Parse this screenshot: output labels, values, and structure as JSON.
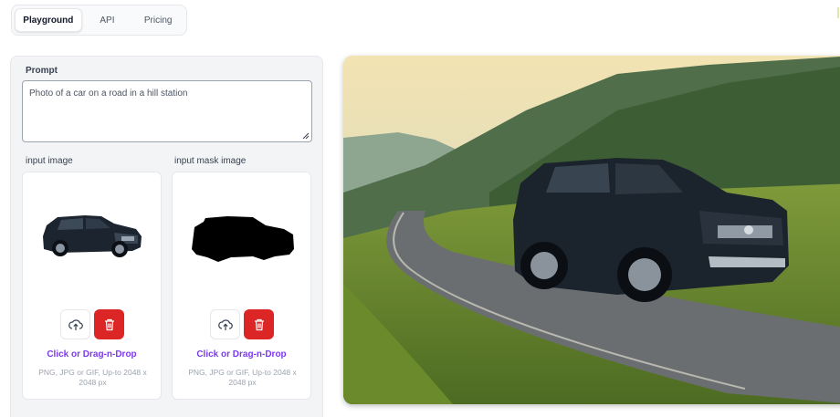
{
  "tabs": [
    {
      "label": "Playground",
      "active": true
    },
    {
      "label": "API",
      "active": false
    },
    {
      "label": "Pricing",
      "active": false
    }
  ],
  "prompt": {
    "label": "Prompt",
    "value": "Photo of a car on a road in a hill station"
  },
  "input_image": {
    "label": "input image",
    "dropzone_text": "Click or Drag-n-Drop",
    "hint": "PNG, JPG or GIF, Up-to 2048 x 2048 px",
    "upload_icon": "cloud-upload-icon",
    "delete_icon": "trash-icon"
  },
  "mask_image": {
    "label": "input mask image",
    "dropzone_text": "Click or Drag-n-Drop",
    "hint": "PNG, JPG or GIF, Up-to 2048 x 2048 px",
    "upload_icon": "cloud-upload-icon",
    "delete_icon": "trash-icon"
  },
  "colors": {
    "accent": "#7c3aed",
    "delete": "#dc2626",
    "panel": "#f3f4f6"
  }
}
